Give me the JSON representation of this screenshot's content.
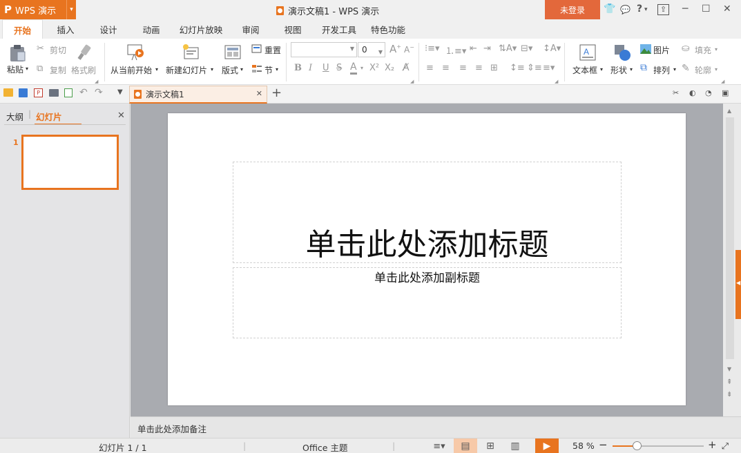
{
  "app": {
    "logo_mark": "P",
    "logo_text": "WPS 演示",
    "logo_dropdown": "▾",
    "window_title": "演示文稿1 - WPS 演示",
    "login": "未登录"
  },
  "title_icons": {
    "skin": "👕",
    "chat": "💬",
    "help": "?",
    "help_dd": "▾",
    "share": "⇪",
    "minimize": "─",
    "maximize": "☐",
    "close": "✕"
  },
  "tabs": [
    "开始",
    "插入",
    "设计",
    "动画",
    "幻灯片放映",
    "审阅",
    "视图",
    "开发工具",
    "特色功能"
  ],
  "ribbon": {
    "paste": "粘贴",
    "cut": "剪切",
    "copy": "复制",
    "format_painter": "格式刷",
    "from_current": "从当前开始",
    "new_slide": "新建幻灯片",
    "layout": "版式",
    "reset": "重置",
    "section": "节",
    "font_name": "",
    "font_size": "0",
    "bold": "B",
    "italic": "I",
    "underline": "U",
    "strike": "S",
    "fontcolor": "A",
    "superscript": "X²",
    "subscript": "X₂",
    "textbox": "文本框",
    "shape": "形状",
    "picture": "图片",
    "arrange": "排列",
    "fill": "填充",
    "outline": "轮廓"
  },
  "doc_tab": {
    "name": "演示文稿1",
    "close": "✕",
    "add": "+"
  },
  "left_pane": {
    "outline_tab": "大纲",
    "slides_tab": "幻灯片",
    "close": "✕",
    "slide_number": "1"
  },
  "slide": {
    "title_placeholder": "单击此处添加标题",
    "subtitle_placeholder": "单击此处添加副标题"
  },
  "notes_placeholder": "单击此处添加备注",
  "status": {
    "slide_counter": "幻灯片 1 / 1",
    "theme": "Office 主题",
    "zoom": "58 %",
    "zoom_minus": "−",
    "zoom_plus": "+",
    "zoom_level": 0.58,
    "fit": "⤢"
  },
  "colors": {
    "accent": "#e8741f",
    "login_bg": "#e3683b"
  }
}
